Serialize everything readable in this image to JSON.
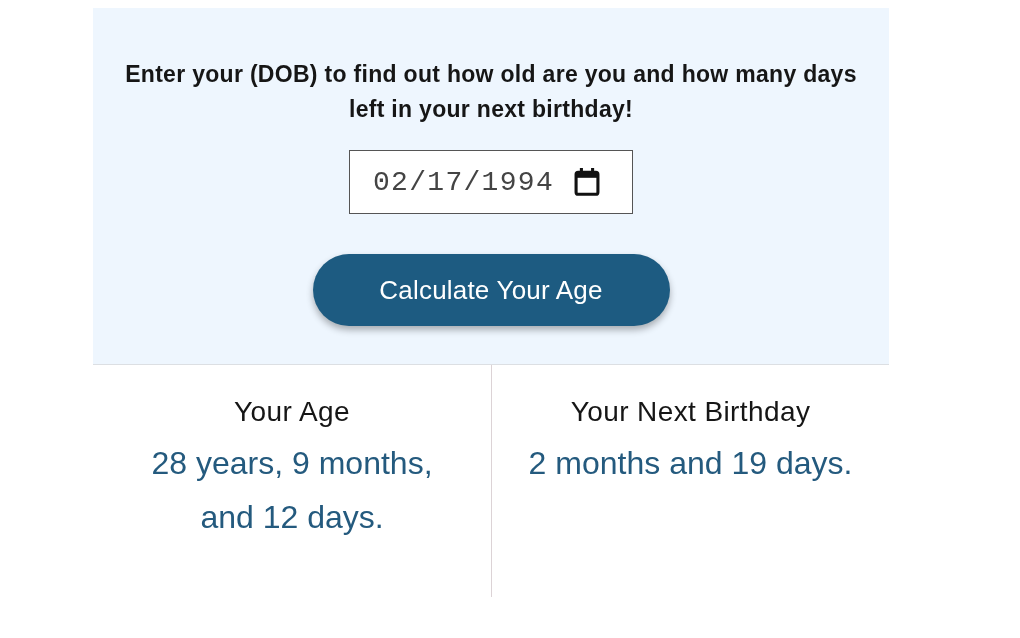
{
  "intro": "Enter your (DOB) to find out how old are you and how many days left in your next birthday!",
  "date_input": {
    "value": "02/17/1994"
  },
  "button": {
    "label": "Calculate Your Age"
  },
  "results": [
    {
      "title": "Your Age",
      "value": "28 years, 9 months, and 12 days."
    },
    {
      "title": "Your Next Birthday",
      "value": "2 months and 19 days."
    }
  ]
}
